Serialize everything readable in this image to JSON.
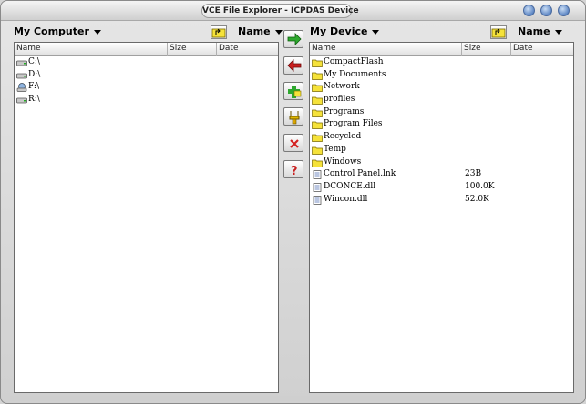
{
  "window": {
    "title": "VCE File Explorer - ICPDAS Device"
  },
  "left_pane": {
    "location": "My Computer",
    "sort_label": "Name",
    "columns": [
      "Name",
      "Size",
      "Date"
    ],
    "items": [
      {
        "name": "C:\\",
        "icon": "hard-drive-icon"
      },
      {
        "name": "D:\\",
        "icon": "hard-drive-icon"
      },
      {
        "name": "F:\\",
        "icon": "network-drive-icon"
      },
      {
        "name": "R:\\",
        "icon": "hard-drive-icon"
      }
    ]
  },
  "right_pane": {
    "location": "My Device",
    "sort_label": "Name",
    "columns": [
      "Name",
      "Size",
      "Date"
    ],
    "items": [
      {
        "name": "CompactFlash",
        "size": "",
        "icon": "folder-icon"
      },
      {
        "name": "My Documents",
        "size": "",
        "icon": "folder-icon"
      },
      {
        "name": "Network",
        "size": "",
        "icon": "folder-icon"
      },
      {
        "name": "profiles",
        "size": "",
        "icon": "folder-icon"
      },
      {
        "name": "Programs",
        "size": "",
        "icon": "folder-icon"
      },
      {
        "name": "Program Files",
        "size": "",
        "icon": "folder-icon"
      },
      {
        "name": "Recycled",
        "size": "",
        "icon": "folder-icon"
      },
      {
        "name": "Temp",
        "size": "",
        "icon": "folder-icon"
      },
      {
        "name": "Windows",
        "size": "",
        "icon": "folder-icon"
      },
      {
        "name": "Control Panel.lnk",
        "size": "23B",
        "icon": "file-icon"
      },
      {
        "name": "DCONCE.dll",
        "size": "100.0K",
        "icon": "file-icon"
      },
      {
        "name": "Wincon.dll",
        "size": "52.0K",
        "icon": "file-icon"
      }
    ]
  },
  "toolbar": {
    "buttons": [
      {
        "icon": "arrow-right-icon",
        "name": "upload-button"
      },
      {
        "icon": "arrow-left-icon",
        "name": "download-button"
      },
      {
        "icon": "new-folder-icon",
        "name": "new-folder-button"
      },
      {
        "icon": "tools-icon",
        "name": "settings-button"
      },
      {
        "icon": "delete-icon",
        "name": "delete-button"
      },
      {
        "icon": "help-icon",
        "name": "help-button"
      }
    ]
  },
  "colors": {
    "folder": "#f5e23a",
    "arrow_green": "#2ea82e",
    "arrow_red": "#c81e1e",
    "window_buttons": "#5d86c4"
  }
}
